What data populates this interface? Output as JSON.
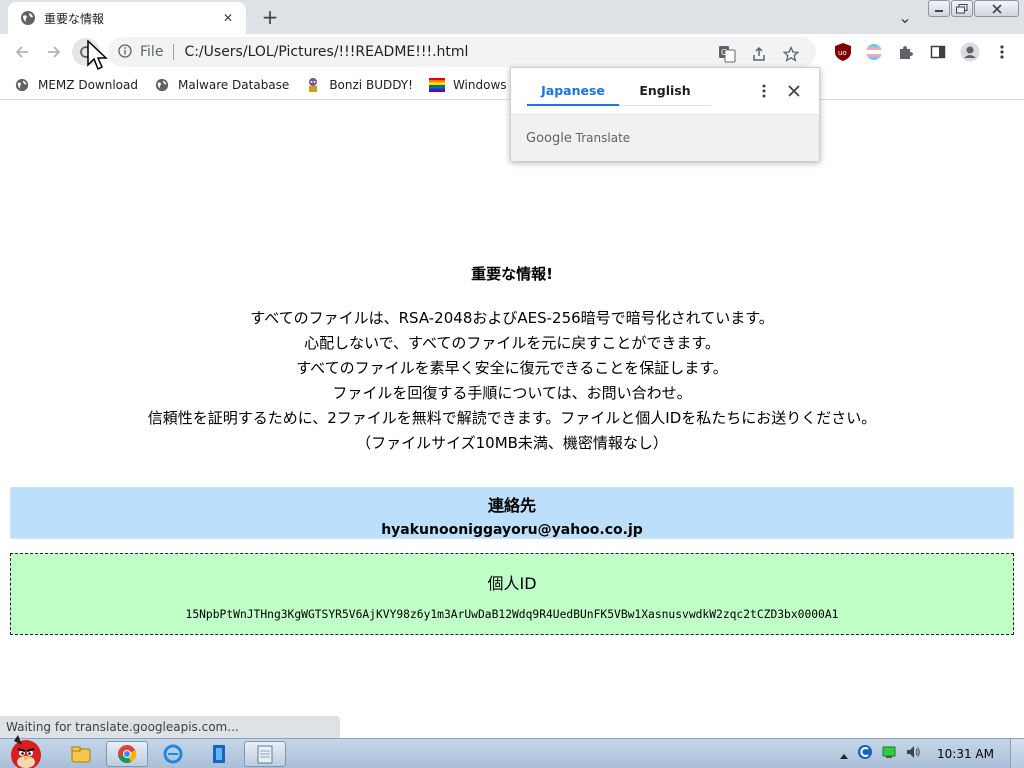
{
  "tab": {
    "title": "重要な情報",
    "close_glyph": "✕",
    "new_tab_glyph": "+"
  },
  "tab_search_glyph": "⌄",
  "address_bar": {
    "scheme_label": "File",
    "url": "C:/Users/LOL/Pictures/!!!README!!!.html"
  },
  "bookmarks": [
    {
      "label": "MEMZ Download",
      "icon": "globe-icon"
    },
    {
      "label": "Malware Database",
      "icon": "globe-icon"
    },
    {
      "label": "Bonzi BUDDY!",
      "icon": "bonzi-icon"
    },
    {
      "label": "Windows IS",
      "icon": "rainbow-flag-icon"
    }
  ],
  "translate_popup": {
    "tabs": [
      {
        "label": "Japanese",
        "active": true
      },
      {
        "label": "English",
        "active": false
      }
    ],
    "brand": "Google",
    "brand_suffix": "Translate"
  },
  "page": {
    "heading": "重要な情報!",
    "lines": [
      "すべてのファイルは、RSA-2048およびAES-256暗号で暗号化されています。",
      "心配しないで、すべてのファイルを元に戻すことができます。",
      "すべてのファイルを素早く安全に復元できることを保証します。",
      "ファイルを回復する手順については、お問い合わせ。",
      "信頼性を証明するために、2ファイルを無料で解読できます。ファイルと個人IDを私たちにお送りください。",
      "（ファイルサイズ10MB未満、機密情報なし）"
    ],
    "contact": {
      "label": "連絡先",
      "email": "hyakunooniggayoru@yahoo.co.jp"
    },
    "personal_id": {
      "label": "個人ID",
      "value": "15NpbPtWnJTHng3KgWGTSYR5V6AjKVY98z6y1m3ArUwDaB12Wdq9R4UedBUnFK5VBw1XasnusvwdkW2zqc2tCZD3bx0000A1"
    }
  },
  "status_bar": "Waiting for translate.googleapis.com...",
  "taskbar": {
    "clock": "10:31 AM"
  },
  "colors": {
    "contact_bg": "#bcdffb",
    "id_bg": "#c0ffc8",
    "translate_accent": "#1a73e8",
    "chrome_frame": "#dee1e6"
  }
}
